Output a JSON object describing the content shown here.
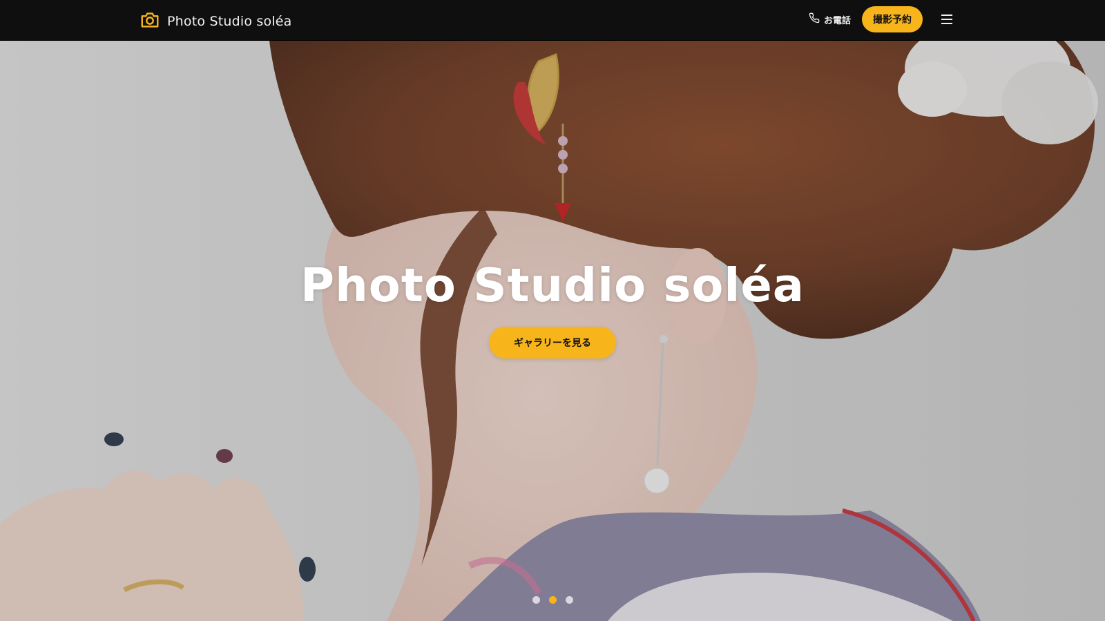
{
  "header": {
    "brand_name": "Photo Studio soléa",
    "phone_label": "お電話",
    "booking_label": "撮影予約",
    "icons": {
      "logo": "camera-icon",
      "phone": "phone-icon",
      "menu": "hamburger-menu-icon"
    }
  },
  "hero": {
    "title": "Photo Studio soléa",
    "cta_label": "ギャラリーを見る",
    "slides": {
      "count": 3,
      "active_index": 1
    }
  },
  "colors": {
    "accent": "#f7b51b",
    "navbar": "#0f0f0f",
    "hero_text": "#ffffff"
  }
}
